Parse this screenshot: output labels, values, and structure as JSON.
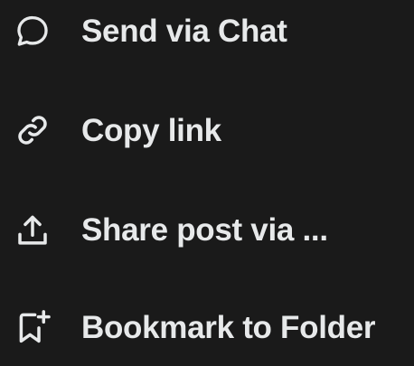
{
  "menu": {
    "items": [
      {
        "label": "Send via Chat",
        "icon": "chat-bubble-icon"
      },
      {
        "label": "Copy link",
        "icon": "link-icon"
      },
      {
        "label": "Share post via ...",
        "icon": "share-upload-icon"
      },
      {
        "label": "Bookmark to Folder",
        "icon": "bookmark-add-icon"
      }
    ]
  },
  "colors": {
    "background": "#1a1a1a",
    "text": "#e7e9ea"
  }
}
